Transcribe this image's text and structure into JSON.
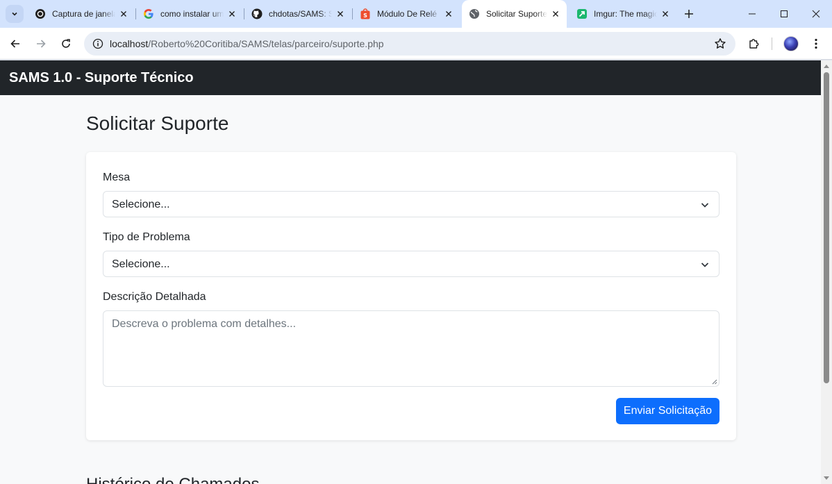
{
  "browser": {
    "tabs": [
      {
        "title": "Captura de janela",
        "favicon": "openai-icon"
      },
      {
        "title": "como instalar um",
        "favicon": "google-icon"
      },
      {
        "title": "chdotas/SAMS: SAMS",
        "favicon": "github-icon"
      },
      {
        "title": "Módulo De Relé",
        "favicon": "shopee-icon"
      },
      {
        "title": "Solicitar Suporte",
        "favicon": "globe-icon",
        "active": true
      },
      {
        "title": "Imgur: The magic",
        "favicon": "imgur-icon"
      }
    ],
    "url": {
      "host": "localhost",
      "path": "/Roberto%20Coritiba/SAMS/telas/parceiro/suporte.php"
    }
  },
  "navbar": {
    "brand": "SAMS 1.0 - Suporte Técnico"
  },
  "page": {
    "title": "Solicitar Suporte",
    "history_title": "Histórico de Chamados"
  },
  "form": {
    "mesa": {
      "label": "Mesa",
      "value": "Selecione..."
    },
    "tipo": {
      "label": "Tipo de Problema",
      "value": "Selecione..."
    },
    "descricao": {
      "label": "Descrição Detalhada",
      "placeholder": "Descreva o problema com detalhes..."
    },
    "submit_label": "Enviar Solicitação"
  },
  "colors": {
    "navbar_bg": "#212529",
    "primary_button": "#0d6efd",
    "page_bg": "#f8f9fa",
    "tabstrip_bg": "#d3e3fd"
  }
}
